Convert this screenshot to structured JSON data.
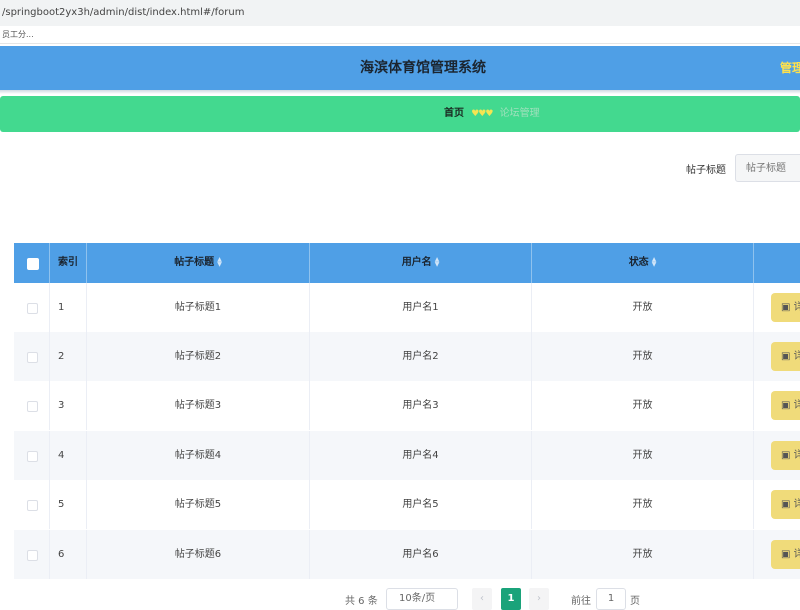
{
  "browser": {
    "url": "/springboot2yx3h/admin/dist/index.html#/forum",
    "bookmark": "员工分..."
  },
  "header": {
    "title": "海滨体育馆管理系统",
    "right_text": "管理"
  },
  "breadcrumb": {
    "home": "首页",
    "separator": "♥♥♥",
    "current": "论坛管理"
  },
  "search": {
    "label": "帖子标题",
    "placeholder": "帖子标题"
  },
  "table": {
    "columns": {
      "index": "索引",
      "title": "帖子标题",
      "username": "用户名",
      "status": "状态"
    },
    "rows": [
      {
        "index": "1",
        "title": "帖子标题1",
        "username": "用户名1",
        "status": "开放",
        "action": "详"
      },
      {
        "index": "2",
        "title": "帖子标题2",
        "username": "用户名2",
        "status": "开放",
        "action": "详"
      },
      {
        "index": "3",
        "title": "帖子标题3",
        "username": "用户名3",
        "status": "开放",
        "action": "详"
      },
      {
        "index": "4",
        "title": "帖子标题4",
        "username": "用户名4",
        "status": "开放",
        "action": "详"
      },
      {
        "index": "5",
        "title": "帖子标题5",
        "username": "用户名5",
        "status": "开放",
        "action": "详"
      },
      {
        "index": "6",
        "title": "帖子标题6",
        "username": "用户名6",
        "status": "开放",
        "action": "详"
      }
    ]
  },
  "pagination": {
    "total": "共 6 条",
    "page_size": "10条/页",
    "prev": "‹",
    "current_page": "1",
    "next": "›",
    "goto_label": "前往",
    "goto_value": "1",
    "page_suffix": "页"
  },
  "colors": {
    "header": "#4f9fe6",
    "breadcrumb": "#43d98f",
    "detail_button": "#f0db7a",
    "current_page": "#1aa37a"
  }
}
